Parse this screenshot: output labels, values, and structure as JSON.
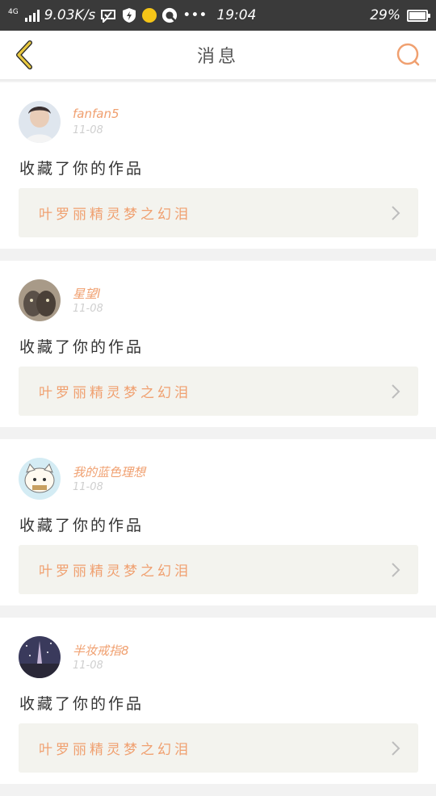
{
  "statusbar": {
    "network_type": "4G",
    "speed": "9.03K/s",
    "time": "19:04",
    "battery": "29%"
  },
  "header": {
    "title": "消息",
    "back_icon": "chevron-left-icon",
    "search_icon": "search-icon"
  },
  "colors": {
    "accent": "#f0a070",
    "back_arrow": "#e8c840",
    "card_link_bg": "#f3f3ee"
  },
  "messages": [
    {
      "user": "fanfan5",
      "date": "11-08",
      "action": "收藏了你的作品",
      "work": "叶罗丽精灵梦之幻泪"
    },
    {
      "user": "星望l",
      "date": "11-08",
      "action": "收藏了你的作品",
      "work": "叶罗丽精灵梦之幻泪"
    },
    {
      "user": "我的蓝色理想",
      "date": "11-08",
      "action": "收藏了你的作品",
      "work": "叶罗丽精灵梦之幻泪"
    },
    {
      "user": "半妆戒指8",
      "date": "11-08",
      "action": "收藏了你的作品",
      "work": "叶罗丽精灵梦之幻泪"
    }
  ]
}
